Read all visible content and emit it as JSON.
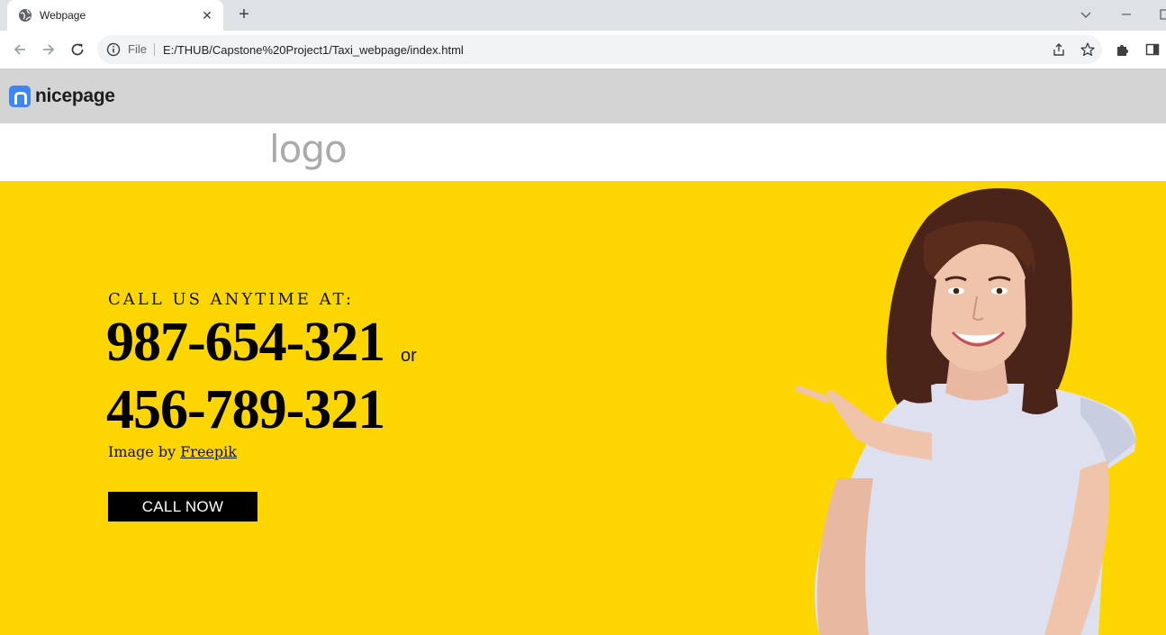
{
  "browser": {
    "tab_title": "Webpage",
    "tab_close": "✕",
    "new_tab": "+",
    "omnibox_label": "File",
    "url": "E:/THUB/Capstone%20Project1/Taxi_webpage/index.html"
  },
  "page": {
    "builder_brand": "nicepage",
    "site_logo": "logo",
    "hero": {
      "kicker": "CALL US ANYTIME AT:",
      "phone_primary": "987-654-321",
      "separator": "or",
      "phone_secondary": "456-789-321",
      "credit_prefix": "Image by ",
      "credit_link": "Freepik",
      "cta_label": "CALL NOW"
    },
    "colors": {
      "hero_background": "#fdd600",
      "nicebar_background": "#d4d4d4",
      "brand_blue": "#3d86f5",
      "cta_background": "#000000"
    }
  }
}
